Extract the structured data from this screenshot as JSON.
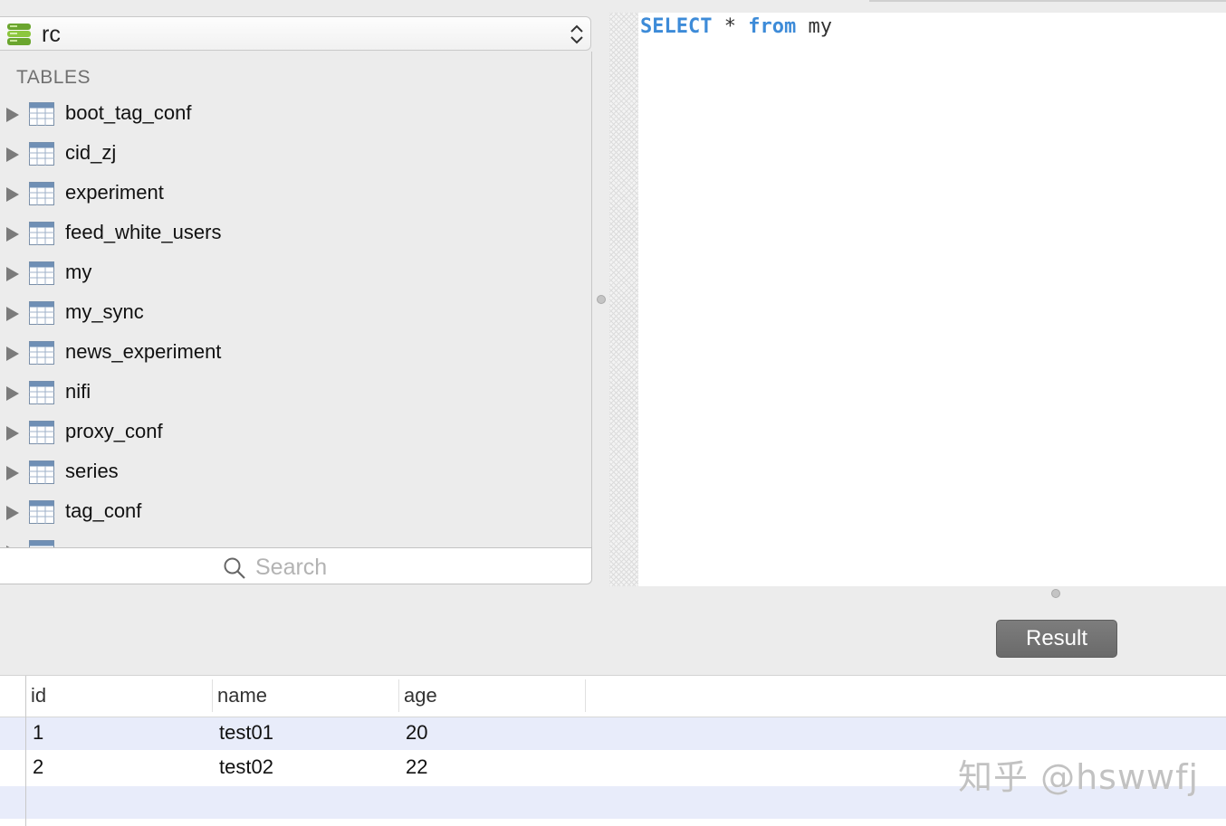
{
  "database": {
    "name": "rc"
  },
  "sidebar": {
    "section_title": "TABLES",
    "tables": [
      "boot_tag_conf",
      "cid_zj",
      "experiment",
      "feed_white_users",
      "my",
      "my_sync",
      "news_experiment",
      "nifi",
      "proxy_conf",
      "series",
      "tag_conf"
    ]
  },
  "search": {
    "placeholder": "Search",
    "value": ""
  },
  "editor": {
    "query_keyword_select": "SELECT",
    "query_star": "*",
    "query_keyword_from": "from",
    "query_table": "my"
  },
  "result_button": {
    "label": "Result"
  },
  "results": {
    "columns": [
      "id",
      "name",
      "age"
    ],
    "rows": [
      [
        "1",
        "test01",
        "20"
      ],
      [
        "2",
        "test02",
        "22"
      ]
    ]
  },
  "watermark": "知乎 @hswwfj",
  "colors": {
    "keyword": "#3d8bd8",
    "row_highlight": "#e8ecfa",
    "button": "#737373"
  }
}
